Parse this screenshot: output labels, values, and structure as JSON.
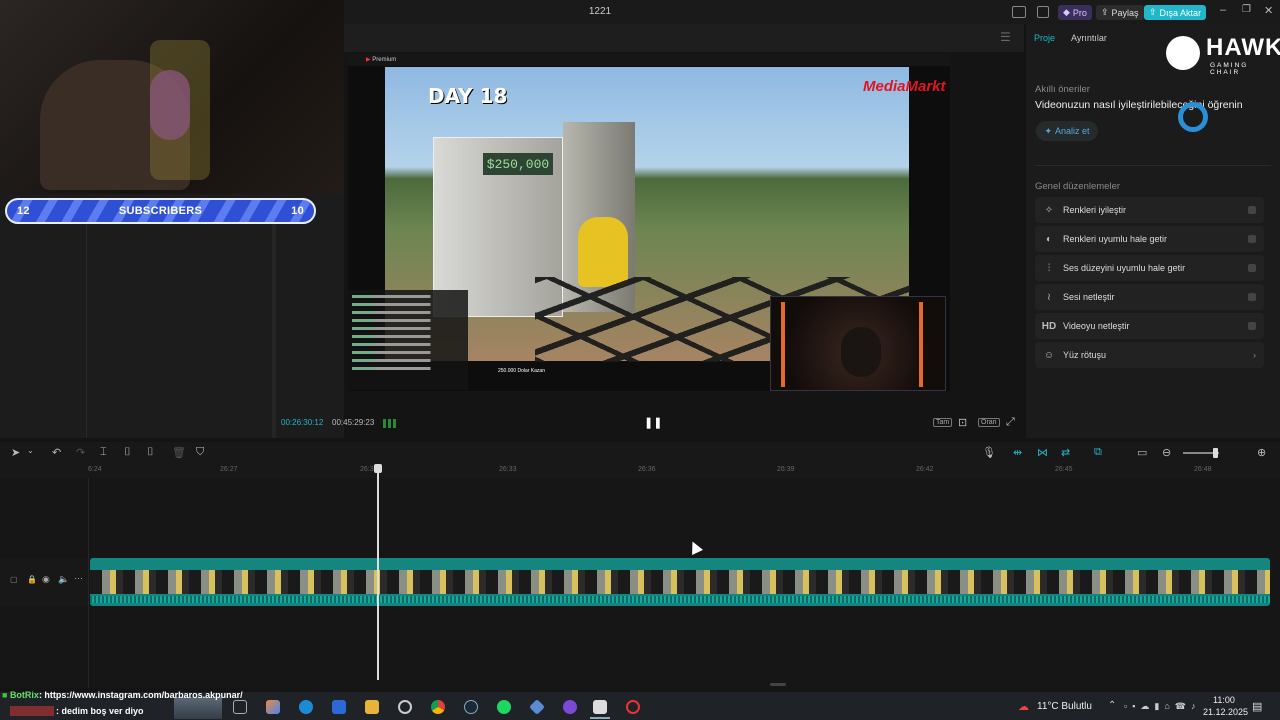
{
  "titlebar": {
    "title": "1221",
    "pro_label": "Pro",
    "share_label": "Paylaş",
    "export_label": "Dışa Aktar"
  },
  "overlay": {
    "subscribers_left": "12",
    "subscribers_label": "SUBSCRIBERS",
    "subscribers_right": "10"
  },
  "video": {
    "day_text": "DAY 18",
    "money_tag": "$250,000",
    "brand_text": "MediaMarkt",
    "youtube_label": "Premium",
    "caption": "250.000 Dolar Kazan"
  },
  "player": {
    "current_time": "00:26:30:12",
    "total_time": "00:45:29:23",
    "full_label": "Tam",
    "ratio_label": "Oran"
  },
  "right_panel": {
    "tab_project": "Proje",
    "tab_details": "Ayrıntılar",
    "logo_big": "HAWK",
    "logo_small": "GAMING CHAIR",
    "smart_title": "Akıllı öneriler",
    "smart_desc": "Videonuzun nasıl iyileştirilebileceğini öğrenin",
    "analyze_label": "Analiz et",
    "general_title": "Genel düzenlemeler",
    "items": [
      {
        "label": "Renkleri iyileştir",
        "icon": "wand-icon"
      },
      {
        "label": "Renkleri uyumlu hale getir",
        "icon": "palette-icon"
      },
      {
        "label": "Ses düzeyini uyumlu hale getir",
        "icon": "sliders-icon"
      },
      {
        "label": "Sesi netleştir",
        "icon": "waveform-icon"
      },
      {
        "label": "Videoyu netleştir",
        "icon": "hd-icon"
      },
      {
        "label": "Yüz rötuşu",
        "icon": "face-icon"
      }
    ]
  },
  "timeline": {
    "ticks": [
      "6:24",
      "26:27",
      "26:30",
      "26:33",
      "26:36",
      "26:39",
      "26:42",
      "26:45",
      "26:48"
    ]
  },
  "chat_overlay": {
    "line1_user": "BotRix",
    "line1_text": ": https://www.instagram.com/barbaros.akpunar/",
    "line2_text": ": dedim boş ver diyo"
  },
  "taskbar": {
    "weather": "11°C  Bulutlu",
    "time": "11:00",
    "date": "21.12.2025"
  },
  "colors": {
    "accent": "#1fb7c9",
    "clip": "#15857f",
    "subscriber_bar": "#3a5ce0"
  }
}
